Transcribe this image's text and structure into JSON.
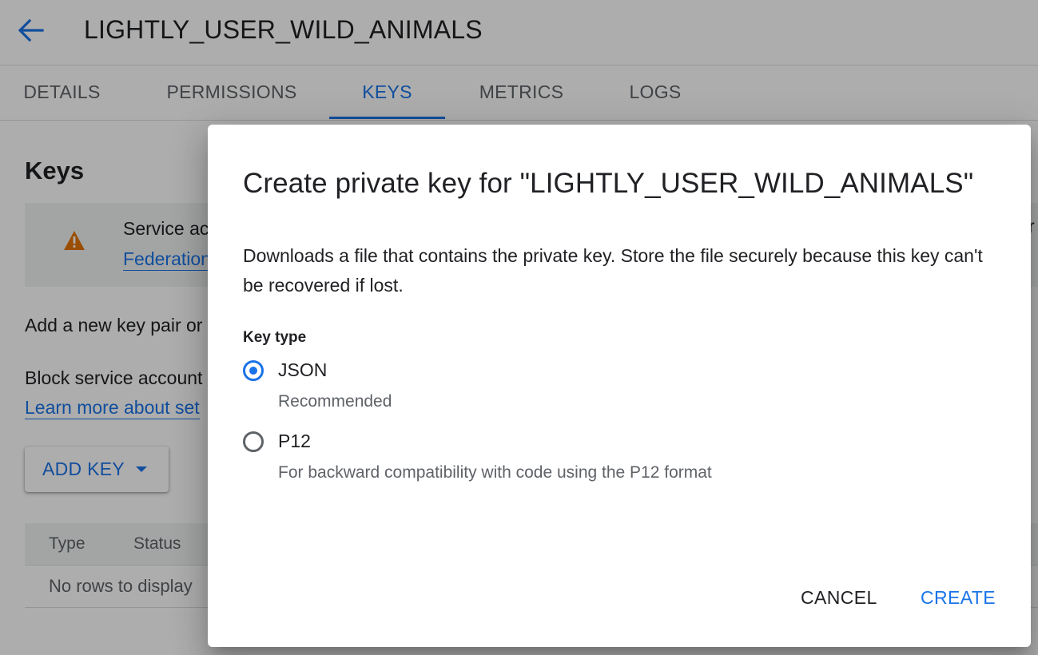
{
  "header": {
    "back_icon": "arrow-back-icon",
    "title": "LIGHTLY_USER_WILD_ANIMALS"
  },
  "tabs": [
    {
      "label": "DETAILS",
      "active": false
    },
    {
      "label": "PERMISSIONS",
      "active": false
    },
    {
      "label": "KEYS",
      "active": true
    },
    {
      "label": "METRICS",
      "active": false
    },
    {
      "label": "LOGS",
      "active": false
    }
  ],
  "content": {
    "title": "Keys",
    "notice": {
      "icon": "warning-icon",
      "text": "Service ac",
      "link": "Federation",
      "overflow_text": "r"
    },
    "line1": "Add a new key pair or",
    "line2": "Block service account",
    "learn_more_link": "Learn more about set",
    "add_key_label": "ADD KEY",
    "table": {
      "columns": [
        "Type",
        "Status"
      ],
      "empty_text": "No rows to display"
    }
  },
  "dialog": {
    "title": "Create private key for \"LIGHTLY_USER_WILD_ANIMALS\"",
    "description": "Downloads a file that contains the private key. Store the file securely because this key can't be recovered if lost.",
    "key_type_label": "Key type",
    "options": [
      {
        "label": "JSON",
        "help": "Recommended",
        "selected": true
      },
      {
        "label": "P12",
        "help": "For backward compatibility with code using the P12 format",
        "selected": false
      }
    ],
    "cancel_label": "CANCEL",
    "create_label": "CREATE"
  },
  "colors": {
    "accent": "#1a73e8",
    "warning": "#e37400",
    "scrim": "rgba(0,0,0,0.32)"
  }
}
